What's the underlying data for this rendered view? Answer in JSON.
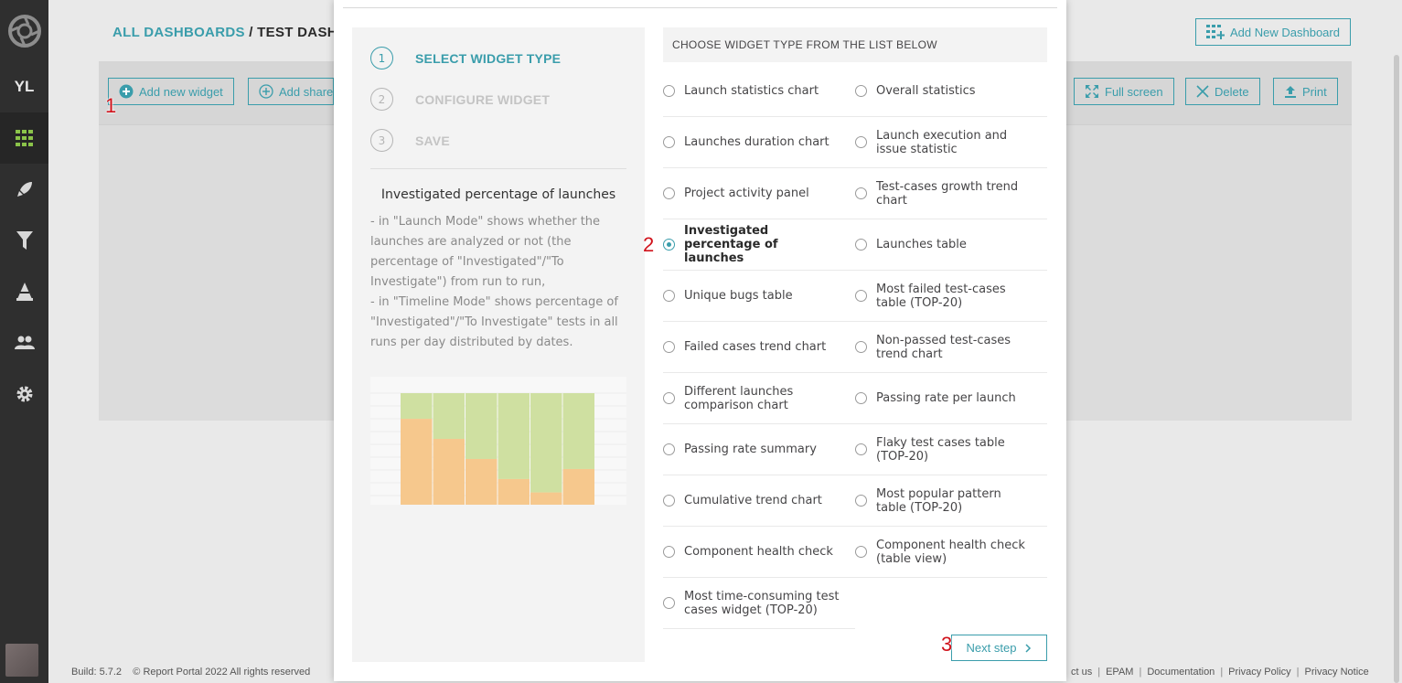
{
  "sidebar": {
    "user_initials": "YL",
    "items": [
      {
        "icon": "dashboard-grid-icon"
      },
      {
        "icon": "rocket-launches-icon"
      },
      {
        "icon": "filter-icon"
      },
      {
        "icon": "debug-icon"
      },
      {
        "icon": "members-icon"
      },
      {
        "icon": "settings-gear-icon"
      }
    ]
  },
  "breadcrumb": {
    "root": "ALL DASHBOARDS",
    "separator": " / ",
    "current": "TEST DASHBOAR"
  },
  "header_buttons": {
    "add_new_dashboard": "Add New Dashboard",
    "add_new_widget": "Add new widget",
    "add_shared": "Add share",
    "full_screen": "Full screen",
    "delete": "Delete",
    "print": "Print"
  },
  "footer": {
    "build": "Build: 5.7.2",
    "copyright": "© Report Portal 2022 All rights reserved",
    "links": [
      "ct us",
      "EPAM",
      "Documentation",
      "Privacy Policy",
      "Privacy Notice"
    ]
  },
  "annotations": [
    "1",
    "2",
    "3"
  ],
  "modal": {
    "steps": [
      {
        "num": "1",
        "label": "SELECT WIDGET TYPE",
        "active": true
      },
      {
        "num": "2",
        "label": "CONFIGURE WIDGET",
        "active": false
      },
      {
        "num": "3",
        "label": "SAVE",
        "active": false
      }
    ],
    "description": {
      "title": "Investigated percentage of launches",
      "lines": [
        "- in \"Launch Mode\" shows whether the launches are analyzed or not (the percentage of \"Investigated\"/\"To Investigate\") from run to run,",
        "- in \"Timeline Mode\" shows percentage of \"Investigated\"/\"To Investigate\" tests in all runs per day distributed by dates."
      ]
    },
    "preview_chart": {
      "to_investigate_fractions": [
        0.77,
        0.59,
        0.41,
        0.23,
        0.11,
        0.32
      ],
      "colors": {
        "investigated": "#cfe0a1",
        "to_investigate": "#f6c88d"
      }
    },
    "list_header": "CHOOSE WIDGET TYPE FROM THE LIST BELOW",
    "widget_types": [
      {
        "label": "Launch statistics chart",
        "selected": false
      },
      {
        "label": "Overall statistics",
        "selected": false
      },
      {
        "label": "Launches duration chart",
        "selected": false
      },
      {
        "label": "Launch execution and issue statistic",
        "selected": false
      },
      {
        "label": "Project activity panel",
        "selected": false
      },
      {
        "label": "Test-cases growth trend chart",
        "selected": false
      },
      {
        "label": "Investigated percentage of launches",
        "selected": true
      },
      {
        "label": "Launches table",
        "selected": false
      },
      {
        "label": "Unique bugs table",
        "selected": false
      },
      {
        "label": "Most failed test-cases table (TOP-20)",
        "selected": false
      },
      {
        "label": "Failed cases trend chart",
        "selected": false
      },
      {
        "label": "Non-passed test-cases trend chart",
        "selected": false
      },
      {
        "label": "Different launches comparison chart",
        "selected": false
      },
      {
        "label": "Passing rate per launch",
        "selected": false
      },
      {
        "label": "Passing rate summary",
        "selected": false
      },
      {
        "label": "Flaky test cases table (TOP-20)",
        "selected": false
      },
      {
        "label": "Cumulative trend chart",
        "selected": false
      },
      {
        "label": "Most popular pattern table (TOP-20)",
        "selected": false
      },
      {
        "label": "Component health check",
        "selected": false
      },
      {
        "label": "Component health check (table view)",
        "selected": false
      },
      {
        "label": "Most time-consuming test cases widget (TOP-20)",
        "selected": false
      }
    ],
    "next_button": "Next step"
  },
  "colors": {
    "accent": "#3a9dab",
    "sidebar_active": "#a2d04a",
    "annotation": "#d0121b"
  }
}
